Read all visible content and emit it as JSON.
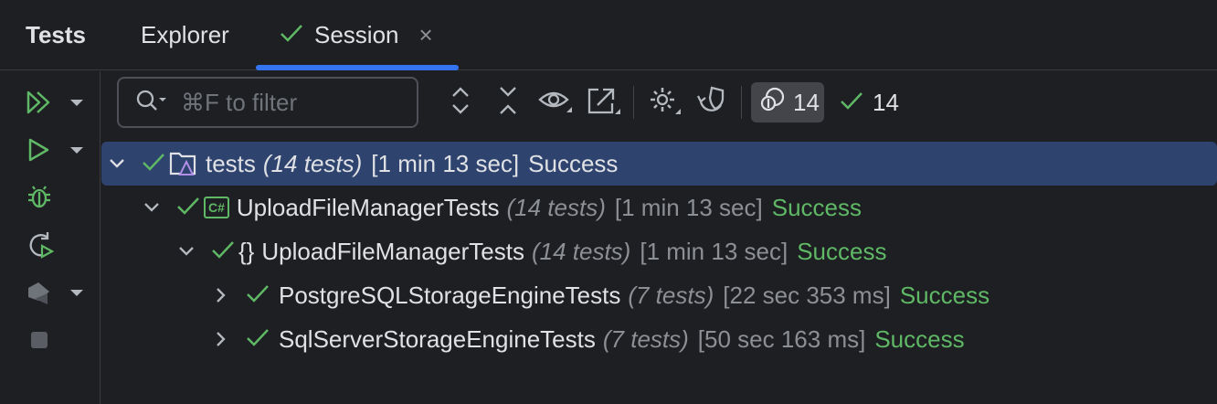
{
  "tabs": {
    "title": "Tests",
    "explorer": "Explorer",
    "session": "Session",
    "session_close": "×"
  },
  "toolbar": {
    "search_placeholder": "⌘F to filter",
    "total_count": "14",
    "passed_count": "14"
  },
  "tree": [
    {
      "name": "tests",
      "count": "(14 tests)",
      "time": "[1 min 13 sec]",
      "status": "Success",
      "icon": "folder-test-icon",
      "expanded": true
    },
    {
      "name": "UploadFileManagerTests",
      "count": "(14 tests)",
      "time": "[1 min 13 sec]",
      "status": "Success",
      "icon": "csharp-project-icon",
      "icon_text": "C#",
      "expanded": true
    },
    {
      "name": "UploadFileManagerTests",
      "count": "(14 tests)",
      "time": "[1 min 13 sec]",
      "status": "Success",
      "icon": "namespace-icon",
      "icon_text": "{}",
      "expanded": true
    },
    {
      "name": "PostgreSQLStorageEngineTests",
      "count": "(7 tests)",
      "time": "[22 sec 353 ms]",
      "status": "Success",
      "expanded": false
    },
    {
      "name": "SqlServerStorageEngineTests",
      "count": "(7 tests)",
      "time": "[50 sec 163 ms]",
      "status": "Success",
      "expanded": false
    }
  ],
  "colors": {
    "accent": "#3574f0",
    "success": "#5fb865",
    "selection": "#2e436e",
    "background": "#1e1f22"
  }
}
